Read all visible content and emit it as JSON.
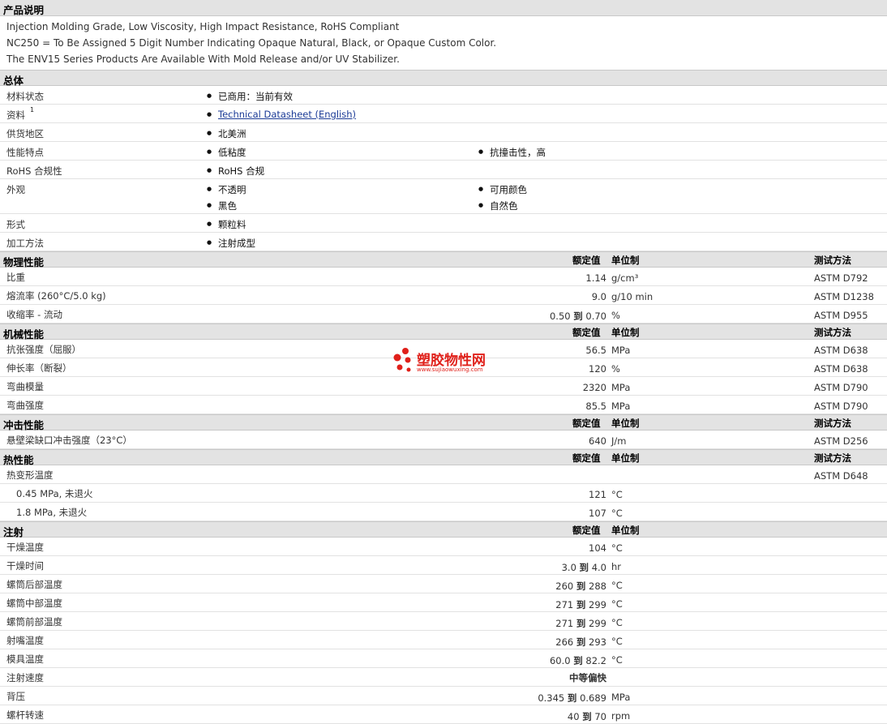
{
  "sections": {
    "desc_title": "产品说明",
    "general_title": "总体",
    "physical_title": "物理性能",
    "mechanical_title": "机械性能",
    "impact_title": "冲击性能",
    "thermal_title": "热性能",
    "injection_title": "注射"
  },
  "headers": {
    "nominal": "额定值",
    "unit": "单位制",
    "method": "测试方法"
  },
  "description": [
    "Injection Molding Grade, Low Viscosity, High Impact Resistance, RoHS Compliant",
    "NC250 = To Be Assigned 5 Digit Number Indicating Opaque Natural, Black, or Opaque Custom Color.",
    "The ENV15 Series Products Are Available With Mold Release and/or UV Stabilizer."
  ],
  "general": [
    {
      "label": "材料状态",
      "values": [
        "已商用：当前有效"
      ]
    },
    {
      "label": "资料",
      "sup": "1",
      "link": "Technical Datasheet (English)"
    },
    {
      "label": "供货地区",
      "values": [
        "北美洲"
      ]
    },
    {
      "label": "性能特点",
      "values": [
        "低粘度",
        "抗撞击性，高"
      ]
    },
    {
      "label": "RoHS 合规性",
      "values": [
        "RoHS 合规"
      ]
    },
    {
      "label": "外观",
      "values": [
        "不透明",
        "可用颜色",
        "黑色",
        "自然色"
      ]
    },
    {
      "label": "形式",
      "values": [
        "颗粒料"
      ]
    },
    {
      "label": "加工方法",
      "values": [
        "注射成型"
      ]
    }
  ],
  "physical": [
    {
      "label": "比重",
      "value": "1.14",
      "unit": "g/cm³",
      "method": "ASTM D792"
    },
    {
      "label": "熔流率  (260°C/5.0 kg)",
      "value": "9.0",
      "unit": "g/10 min",
      "method": "ASTM D1238"
    },
    {
      "label": "收缩率  - 流动",
      "from": "0.50",
      "to": "0.70",
      "sep": "到",
      "unit": "%",
      "method": "ASTM D955"
    }
  ],
  "mechanical": [
    {
      "label": "抗张强度（屈服）",
      "value": "56.5",
      "unit": "MPa",
      "method": "ASTM D638"
    },
    {
      "label": "伸长率（断裂）",
      "value": "120",
      "unit": "%",
      "method": "ASTM D638"
    },
    {
      "label": "弯曲模量",
      "value": "2320",
      "unit": "MPa",
      "method": "ASTM D790"
    },
    {
      "label": "弯曲强度",
      "value": "85.5",
      "unit": "MPa",
      "method": "ASTM D790"
    }
  ],
  "impact": [
    {
      "label": "悬壁梁缺口冲击强度（23°C）",
      "value": "640",
      "unit": "J/m",
      "method": "ASTM D256"
    }
  ],
  "thermal": [
    {
      "label": "热变形温度",
      "value": "",
      "unit": "",
      "method": "ASTM D648"
    },
    {
      "label": "0.45 MPa, 未退火",
      "value": "121",
      "unit": "°C",
      "method": "",
      "indent": true
    },
    {
      "label": "1.8 MPa, 未退火",
      "value": "107",
      "unit": "°C",
      "method": "",
      "indent": true
    }
  ],
  "injection": [
    {
      "label": "干燥温度",
      "value": "104",
      "unit": "°C"
    },
    {
      "label": "干燥时间",
      "from": "3.0",
      "to": "4.0",
      "sep": "到",
      "unit": "hr"
    },
    {
      "label": "螺筒后部温度",
      "from": "260",
      "to": "288",
      "sep": "到",
      "unit": "°C"
    },
    {
      "label": "螺筒中部温度",
      "from": "271",
      "to": "299",
      "sep": "到",
      "unit": "°C"
    },
    {
      "label": "螺筒前部温度",
      "from": "271",
      "to": "299",
      "sep": "到",
      "unit": "°C"
    },
    {
      "label": "射嘴温度",
      "from": "266",
      "to": "293",
      "sep": "到",
      "unit": "°C"
    },
    {
      "label": "模具温度",
      "from": "60.0",
      "to": "82.2",
      "sep": "到",
      "unit": "°C"
    },
    {
      "label": "注射速度",
      "value": "中等偏快",
      "unit": "",
      "centered": true
    },
    {
      "label": "背压",
      "from": "0.345",
      "to": "0.689",
      "sep": "到",
      "unit": "MPa"
    },
    {
      "label": "螺杆转速",
      "from": "40",
      "to": "70",
      "sep": "到",
      "unit": "rpm"
    }
  ],
  "watermark": {
    "name": "塑胶物性网",
    "url": "www.sujiaowuxing.com"
  },
  "colors": {
    "section_bg": "#e3e3e3",
    "link": "#1a3a96",
    "watermark": "#e0201a"
  }
}
